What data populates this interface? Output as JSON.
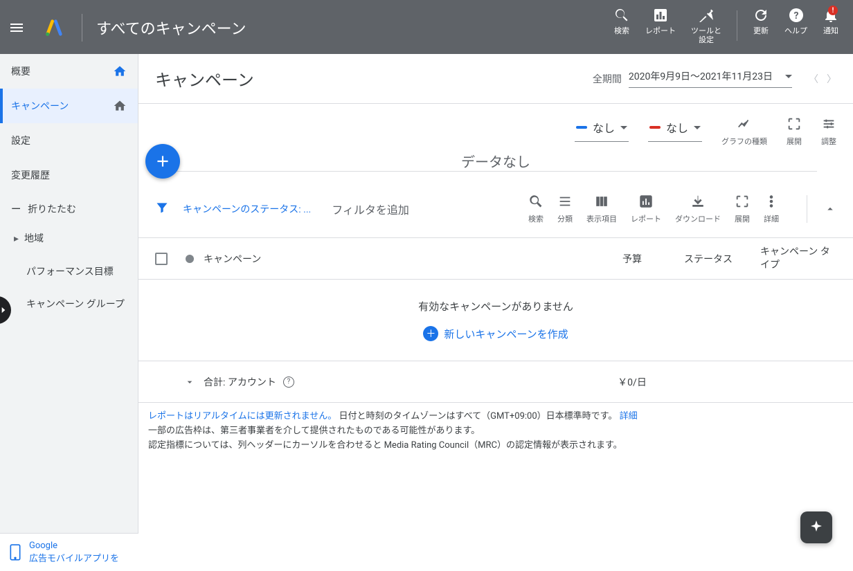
{
  "header": {
    "title": "すべてのキャンペーン",
    "tools": {
      "search": "検索",
      "reports": "レポート",
      "tools_settings": "ツールと\n設定",
      "refresh": "更新",
      "help": "ヘルプ",
      "notifications": "通知",
      "notif_badge": "!"
    }
  },
  "sidebar": {
    "overview": "概要",
    "campaigns": "キャンペーン",
    "settings": "設定",
    "change_history": "変更履歴",
    "collapse": "折りたたむ",
    "locations": "地域",
    "performance_targets": "パフォーマンス目標",
    "campaign_groups": "キャンペーン グループ"
  },
  "page": {
    "title": "キャンペーン",
    "date_label": "全期間",
    "date_value": "2020年9月9日～2021年11月23日"
  },
  "chart": {
    "metric1": "なし",
    "metric2": "なし",
    "chart_type": "グラフの種類",
    "expand": "展開",
    "adjust": "調整",
    "no_data": "データなし"
  },
  "toolbar": {
    "status_filter": "キャンペーンのステータス: ...",
    "add_filter": "フィルタを追加",
    "search": "検索",
    "segment": "分類",
    "columns": "表示項目",
    "reports": "レポート",
    "download": "ダウンロード",
    "expand": "展開",
    "more": "詳細"
  },
  "table": {
    "col_campaign": "キャンペーン",
    "col_budget": "予算",
    "col_status": "ステータス",
    "col_type": "キャンペーン タイプ",
    "empty_msg": "有効なキャンペーンがありません",
    "create_new": "新しいキャンペーンを作成",
    "total_label": "合計: アカウント",
    "total_budget": "￥0/日"
  },
  "footer": {
    "line1a": "レポートはリアルタイムには更新されません。",
    "line1b": " 日付と時刻のタイムゾーンはすべて（GMT+09:00）日本標準時です。 ",
    "detail": "詳細",
    "line2": "一部の広告枠は、第三者事業者を介して提供されたものである可能性があります。",
    "line3": "認定指標については、列ヘッダーにカーソルを合わせると Media Rating Council（MRC）の認定情報が表示されます。"
  },
  "promo": {
    "line1": "Google",
    "line2": "広告モバイルアプリを"
  }
}
